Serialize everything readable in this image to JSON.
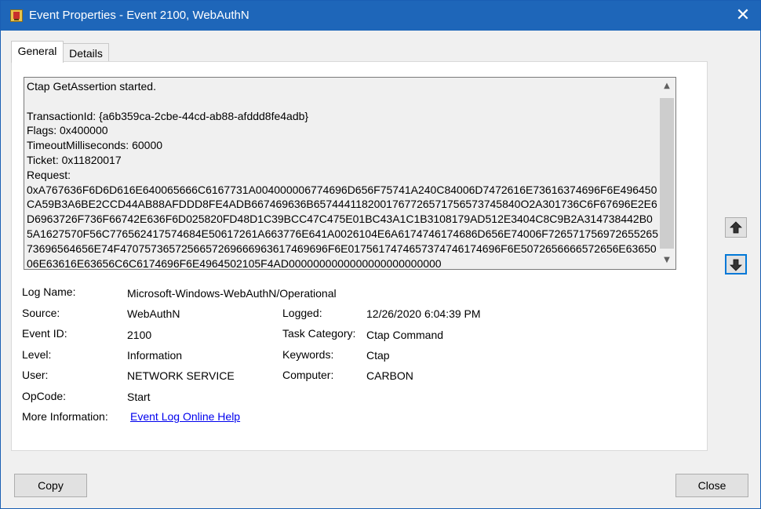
{
  "window": {
    "title": "Event Properties - Event 2100, WebAuthN",
    "close_glyph": "✕"
  },
  "tabs": [
    {
      "label": "General",
      "selected": true
    },
    {
      "label": "Details",
      "selected": false
    }
  ],
  "message": {
    "text": "Ctap GetAssertion started.\n\nTransactionId: {a6b359ca-2cbe-44cd-ab88-afddd8fe4adb}\nFlags: 0x400000\nTimeoutMilliseconds: 60000\nTicket: 0x11820017\nRequest:\n0xA767636F6D6D616E640065666C6167731A004000006774696D656F75741A240C84006D7472616E73616374696F6E496450CA59B3A6BE2CCD44AB88AFDDD8FE4ADB667469636B6574441182001767726571756573745840O2A301736C6F67696E2E6D6963726F736F66742E636F6D025820FD48D1C39BCC47C475E01BC43A1C1B3108179AD512E3404C8C9B2A314738442B05A1627570F56C776562417574684E50617261A663776E641A0026104E6A6174746174686D656E74006F72657175697265526573696564656E74F4707573657256657269666963617469696F6E0175617474657374746174696F6E5072656666572656E6365006E63616E63656C6C6174696F6E4964502105F4AD0000000000000000000000000",
    "scroll_up": "▲",
    "scroll_down": "▼"
  },
  "fields": {
    "log_name_label": "Log Name:",
    "log_name": "Microsoft-Windows-WebAuthN/Operational",
    "source_label": "Source:",
    "source": "WebAuthN",
    "logged_label": "Logged:",
    "logged": "12/26/2020 6:04:39 PM",
    "event_id_label": "Event ID:",
    "event_id": "2100",
    "task_category_label": "Task Category:",
    "task_category": "Ctap Command",
    "level_label": "Level:",
    "level": "Information",
    "keywords_label": "Keywords:",
    "keywords": "Ctap",
    "user_label": "User:",
    "user": "NETWORK SERVICE",
    "computer_label": "Computer:",
    "computer": "CARBON",
    "opcode_label": "OpCode:",
    "opcode": "Start",
    "more_info_label": "More Information:",
    "more_info_link": "Event Log Online Help"
  },
  "buttons": {
    "copy": "Copy",
    "close": "Close"
  },
  "icons": {
    "app": "event-viewer-icon",
    "previous": "arrow-up-icon",
    "next": "arrow-down-icon"
  },
  "colors": {
    "titlebar": "#1e66b9",
    "focus": "#0078d7",
    "link": "#0000ee"
  }
}
